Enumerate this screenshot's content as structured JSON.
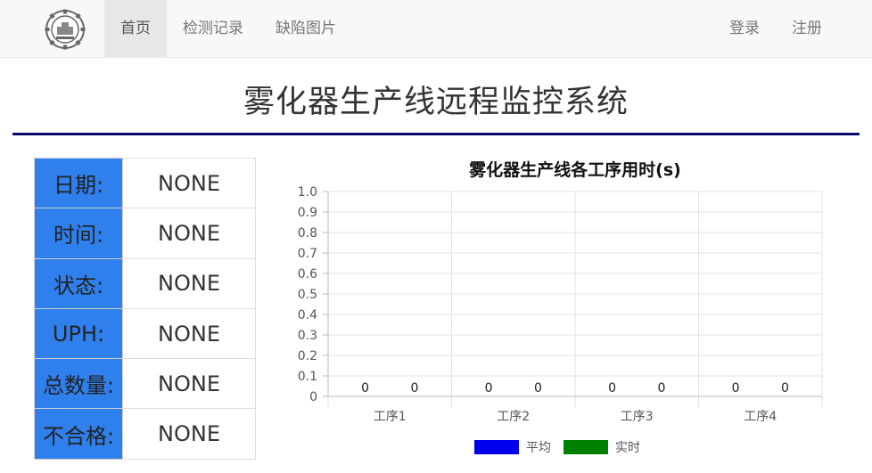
{
  "nav": {
    "logo_icon": "university-emblem-icon",
    "left_items": [
      {
        "label": "首页",
        "active": true
      },
      {
        "label": "检测记录",
        "active": false
      },
      {
        "label": "缺陷图片",
        "active": false
      }
    ],
    "right_items": [
      {
        "label": "登录"
      },
      {
        "label": "注册"
      }
    ]
  },
  "page": {
    "title": "雾化器生产线远程监控系统"
  },
  "info": {
    "label_color": "#2f80ed",
    "rows": [
      {
        "label": "日期:",
        "value": "NONE"
      },
      {
        "label": "时间:",
        "value": "NONE"
      },
      {
        "label": "状态:",
        "value": "NONE"
      },
      {
        "label": "UPH:",
        "value": "NONE"
      },
      {
        "label": "总数量:",
        "value": "NONE"
      },
      {
        "label": "不合格:",
        "value": "NONE"
      }
    ]
  },
  "chart_data": {
    "type": "bar",
    "title": "雾化器生产线各工序用时(s)",
    "categories": [
      "工序1",
      "工序2",
      "工序3",
      "工序4"
    ],
    "series": [
      {
        "name": "平均",
        "values": [
          0,
          0,
          0,
          0
        ],
        "color": "#0000ee"
      },
      {
        "name": "实时",
        "values": [
          0,
          0,
          0,
          0
        ],
        "color": "#008000"
      }
    ],
    "ylim": [
      0,
      1.0
    ],
    "yticks": [
      "0",
      "0.1",
      "0.2",
      "0.3",
      "0.4",
      "0.5",
      "0.6",
      "0.7",
      "0.8",
      "0.9",
      "1.0"
    ],
    "grid": true,
    "legend": "bottom"
  }
}
